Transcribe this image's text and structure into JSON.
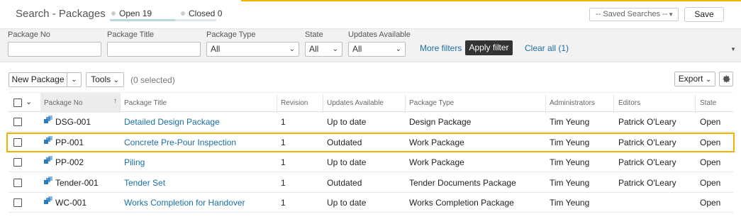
{
  "header": {
    "title": "Search - Packages",
    "tabs": [
      {
        "label": "Open 19",
        "active": true
      },
      {
        "label": "Closed 0",
        "active": false
      }
    ],
    "saved_searches_placeholder": "-- Saved Searches --",
    "save_label": "Save"
  },
  "filters": {
    "package_no_label": "Package No",
    "package_no_value": "",
    "package_title_label": "Package Title",
    "package_title_value": "",
    "package_type_label": "Package Type",
    "package_type_value": "All",
    "state_label": "State",
    "state_value": "All",
    "updates_label": "Updates Available",
    "updates_value": "All",
    "more_filters": "More filters",
    "apply_filter": "Apply filter",
    "clear_all": "Clear all (1)"
  },
  "toolbar": {
    "new_package": "New Package",
    "tools": "Tools",
    "selected_count": "(0 selected)",
    "export": "Export"
  },
  "table": {
    "columns": [
      "Package No",
      "Package Title",
      "Revision",
      "Updates Available",
      "Package Type",
      "Administrators",
      "Editors",
      "State"
    ],
    "sorted_column": "Package No",
    "rows": [
      {
        "no": "DSG-001",
        "title": "Detailed Design Package",
        "revision": "1",
        "updates": "Up to date",
        "type": "Design Package",
        "admins": "Tim Yeung",
        "editors": "Patrick O'Leary",
        "state": "Open",
        "highlighted": false
      },
      {
        "no": "PP-001",
        "title": "Concrete Pre-Pour Inspection",
        "revision": "1",
        "updates": "Outdated",
        "type": "Work Package",
        "admins": "Tim Yeung",
        "editors": "Patrick O'Leary",
        "state": "Open",
        "highlighted": true
      },
      {
        "no": "PP-002",
        "title": "Piling",
        "revision": "1",
        "updates": "Up to date",
        "type": "Work Package",
        "admins": "Tim Yeung",
        "editors": "Patrick O'Leary",
        "state": "Open",
        "highlighted": false
      },
      {
        "no": "Tender-001",
        "title": "Tender Set",
        "revision": "1",
        "updates": "Outdated",
        "type": "Tender Documents Package",
        "admins": "Tim Yeung",
        "editors": "Patrick O'Leary",
        "state": "Open",
        "highlighted": false
      },
      {
        "no": "WC-001",
        "title": "Works Completion for Handover",
        "revision": "1",
        "updates": "Up to date",
        "type": "Works Completion Package",
        "admins": "Tim Yeung",
        "editors": "",
        "state": "Open",
        "highlighted": false
      }
    ]
  },
  "colors": {
    "accent": "#f0b400",
    "link": "#1a6fa3",
    "icon": "#2b7bbf"
  },
  "icons": {
    "package": "package-icon",
    "sort": "sort-asc-icon",
    "settings": "gear-icon"
  }
}
